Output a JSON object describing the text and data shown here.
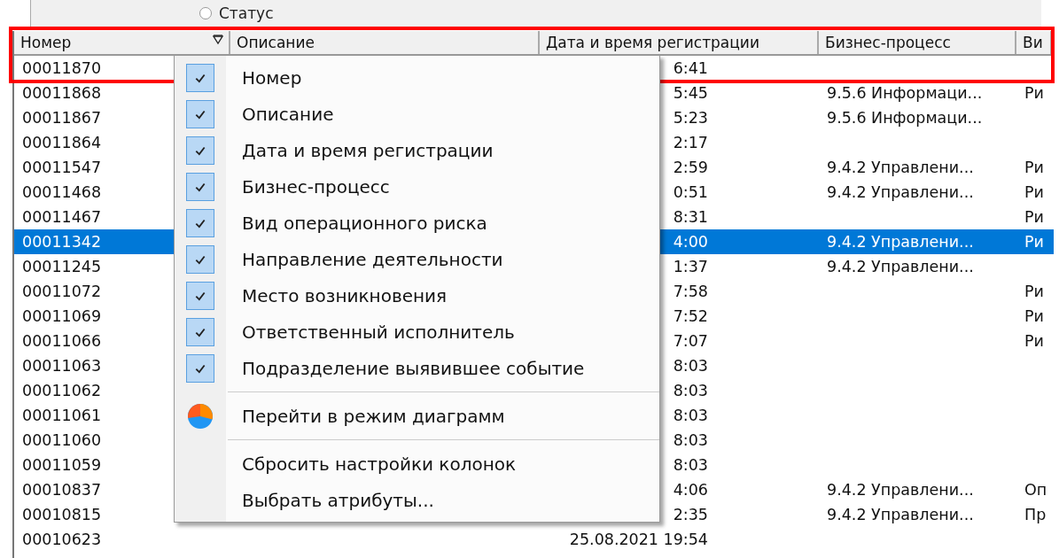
{
  "filter_bar": {
    "radio": {
      "label": "Статус",
      "selected": false
    }
  },
  "table": {
    "columns": [
      {
        "label": "Номер",
        "filter": true
      },
      {
        "label": "Описание",
        "filter": false
      },
      {
        "label": "Дата и время регистрации",
        "filter": false
      },
      {
        "label": "Бизнес-процесс",
        "filter": false
      },
      {
        "label": "Ви",
        "filter": false
      }
    ],
    "rows": [
      {
        "number": "00011870",
        "date": "6:41",
        "process": "",
        "risk": "",
        "selected": false
      },
      {
        "number": "00011868",
        "date": "5:45",
        "process": "9.5.6 Информаци...",
        "risk": "Ри",
        "selected": false
      },
      {
        "number": "00011867",
        "date": "5:23",
        "process": "9.5.6 Информаци...",
        "risk": "",
        "selected": false
      },
      {
        "number": "00011864",
        "date": "2:17",
        "process": "",
        "risk": "",
        "selected": false
      },
      {
        "number": "00011547",
        "date": "2:59",
        "process": "9.4.2 Управлени...",
        "risk": "Ри",
        "selected": false
      },
      {
        "number": "00011468",
        "date": "0:51",
        "process": "9.4.2 Управлени...",
        "risk": "Ри",
        "selected": false
      },
      {
        "number": "00011467",
        "date": "8:31",
        "process": "",
        "risk": "Ри",
        "selected": false
      },
      {
        "number": "00011342",
        "date": "4:00",
        "process": "9.4.2 Управлени...",
        "risk": "Ри",
        "selected": true
      },
      {
        "number": "00011245",
        "date": "1:37",
        "process": "9.4.2 Управлени...",
        "risk": "",
        "selected": false
      },
      {
        "number": "00011072",
        "date": "7:58",
        "process": "",
        "risk": "Ри",
        "selected": false
      },
      {
        "number": "00011069",
        "date": "7:52",
        "process": "",
        "risk": "Ри",
        "selected": false
      },
      {
        "number": "00011066",
        "date": "7:07",
        "process": "",
        "risk": "Ри",
        "selected": false
      },
      {
        "number": "00011063",
        "date": "8:03",
        "process": "",
        "risk": "",
        "selected": false
      },
      {
        "number": "00011062",
        "date": "8:03",
        "process": "",
        "risk": "",
        "selected": false
      },
      {
        "number": "00011061",
        "date": "8:03",
        "process": "",
        "risk": "",
        "selected": false
      },
      {
        "number": "00011060",
        "date": "8:03",
        "process": "",
        "risk": "",
        "selected": false
      },
      {
        "number": "00011059",
        "date": "8:03",
        "process": "",
        "risk": "",
        "selected": false
      },
      {
        "number": "00010837",
        "date": "4:06",
        "process": "9.4.2 Управлени...",
        "risk": "Оп",
        "selected": false
      },
      {
        "number": "00010815",
        "date": "2:35",
        "process": "9.4.2 Управлени...",
        "risk": "Пр",
        "selected": false
      },
      {
        "number": "00010623",
        "date": "25.08.2021 19:54",
        "process": "",
        "risk": "",
        "selected": false
      }
    ]
  },
  "context_menu": {
    "items": [
      {
        "kind": "check",
        "label": "Номер",
        "checked": true
      },
      {
        "kind": "check",
        "label": "Описание",
        "checked": true
      },
      {
        "kind": "check",
        "label": "Дата и время регистрации",
        "checked": true
      },
      {
        "kind": "check",
        "label": "Бизнес-процесс",
        "checked": true
      },
      {
        "kind": "check",
        "label": "Вид операционного риска",
        "checked": true
      },
      {
        "kind": "check",
        "label": "Направление деятельности",
        "checked": true
      },
      {
        "kind": "check",
        "label": "Место возникновения",
        "checked": true
      },
      {
        "kind": "check",
        "label": "Ответственный исполнитель",
        "checked": true
      },
      {
        "kind": "check",
        "label": "Подразделение выявившее событие",
        "checked": true
      },
      {
        "kind": "separator"
      },
      {
        "kind": "chart",
        "label": "Перейти в режим диаграмм"
      },
      {
        "kind": "separator"
      },
      {
        "kind": "plain",
        "label": "Сбросить настройки колонок"
      },
      {
        "kind": "plain",
        "label": "Выбрать атрибуты..."
      }
    ]
  }
}
